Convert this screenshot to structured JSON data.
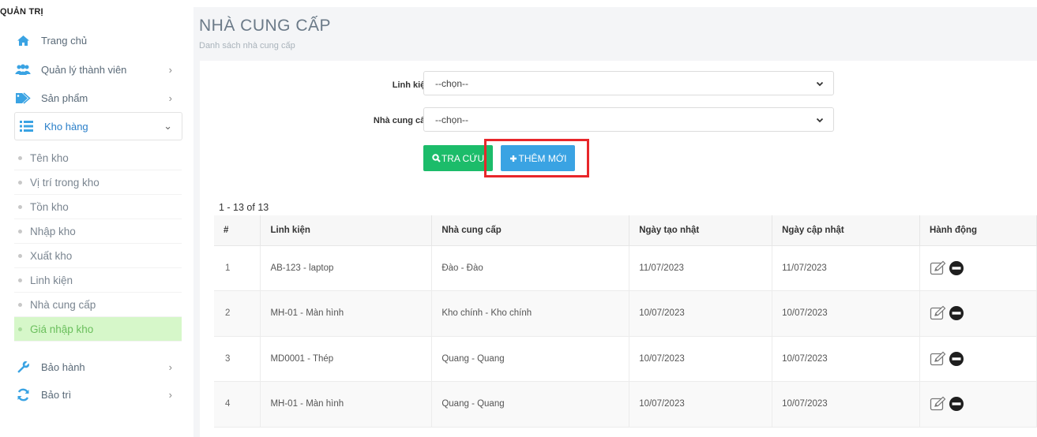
{
  "sidebar": {
    "header": "QUẢN TRỊ",
    "items": [
      {
        "label": "Trang chủ",
        "icon": "home-icon",
        "chevron": ""
      },
      {
        "label": "Quản lý thành viên",
        "icon": "users-icon",
        "chevron": "›"
      },
      {
        "label": "Sản phẩm",
        "icon": "tags-icon",
        "chevron": "›"
      },
      {
        "label": "Kho hàng",
        "icon": "list-icon",
        "chevron": "⌄"
      },
      {
        "label": "Bảo hành",
        "icon": "wrench-icon",
        "chevron": "›"
      },
      {
        "label": "Bảo trì",
        "icon": "refresh-icon",
        "chevron": "›"
      }
    ],
    "submenu": [
      {
        "label": "Tên kho"
      },
      {
        "label": "Vị trí trong kho"
      },
      {
        "label": "Tồn kho"
      },
      {
        "label": "Nhập kho"
      },
      {
        "label": "Xuất kho"
      },
      {
        "label": "Linh kiện"
      },
      {
        "label": "Nhà cung cấp"
      },
      {
        "label": "Giá nhập kho"
      }
    ]
  },
  "page": {
    "title": "NHÀ CUNG CẤP",
    "subtitle": "Danh sách nhà cung cấp"
  },
  "form": {
    "component_label": "Linh kiện",
    "component_value": "--chọn--",
    "supplier_label": "Nhà cung cấp",
    "supplier_value": "--chọn--",
    "search_label": "TRA CỨU",
    "add_label": "THÊM MỚI"
  },
  "pagination": {
    "text": "1 - 13 of 13"
  },
  "table": {
    "headers": [
      "#",
      "Linh kiện",
      "Nhà cung cấp",
      "Ngày tạo nhật",
      "Ngày cập nhật",
      "Hành động"
    ],
    "rows": [
      {
        "num": "1",
        "component": "AB-123 - laptop",
        "supplier": "Đào - Đào",
        "created": "11/07/2023",
        "updated": "11/07/2023"
      },
      {
        "num": "2",
        "component": "MH-01 - Màn hình",
        "supplier": "Kho chính - Kho chính",
        "created": "10/07/2023",
        "updated": "10/07/2023"
      },
      {
        "num": "3",
        "component": "MD0001 - Thép",
        "supplier": "Quang - Quang",
        "created": "10/07/2023",
        "updated": "10/07/2023"
      },
      {
        "num": "4",
        "component": "MH-01 - Màn hình",
        "supplier": "Quang - Quang",
        "created": "10/07/2023",
        "updated": "10/07/2023"
      }
    ]
  },
  "colors": {
    "accent": "#3aa3e3",
    "search_button": "#1cbc6a",
    "highlight": "#e8262a",
    "active_submenu": "#d6f7c9"
  }
}
